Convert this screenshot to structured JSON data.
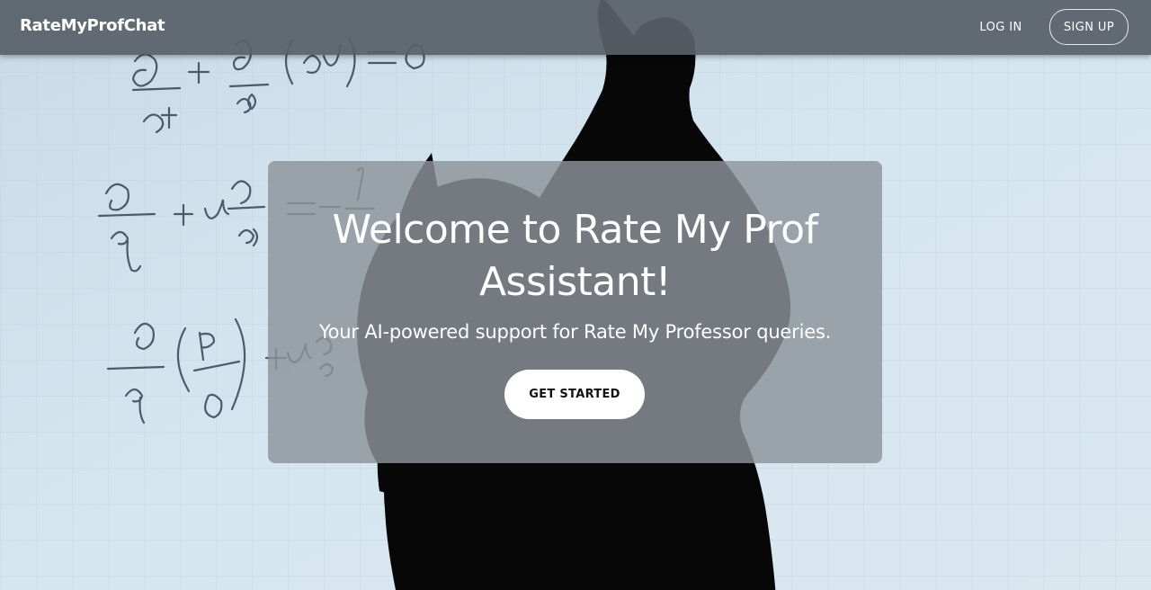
{
  "header": {
    "brand": "RateMyProfChat",
    "login_label": "LOG IN",
    "signup_label": "SIGN UP"
  },
  "hero": {
    "background_image": "silhouette of a student writing equations on a whiteboard",
    "title": "Welcome to Rate My Prof Assistant!",
    "subtitle": "Your AI-powered support for Rate My Professor queries.",
    "cta_label": "GET STARTED"
  },
  "colors": {
    "navbar": "#586068",
    "card": "#8c949a",
    "button_bg": "#ffffff",
    "text_light": "#ffffff"
  }
}
